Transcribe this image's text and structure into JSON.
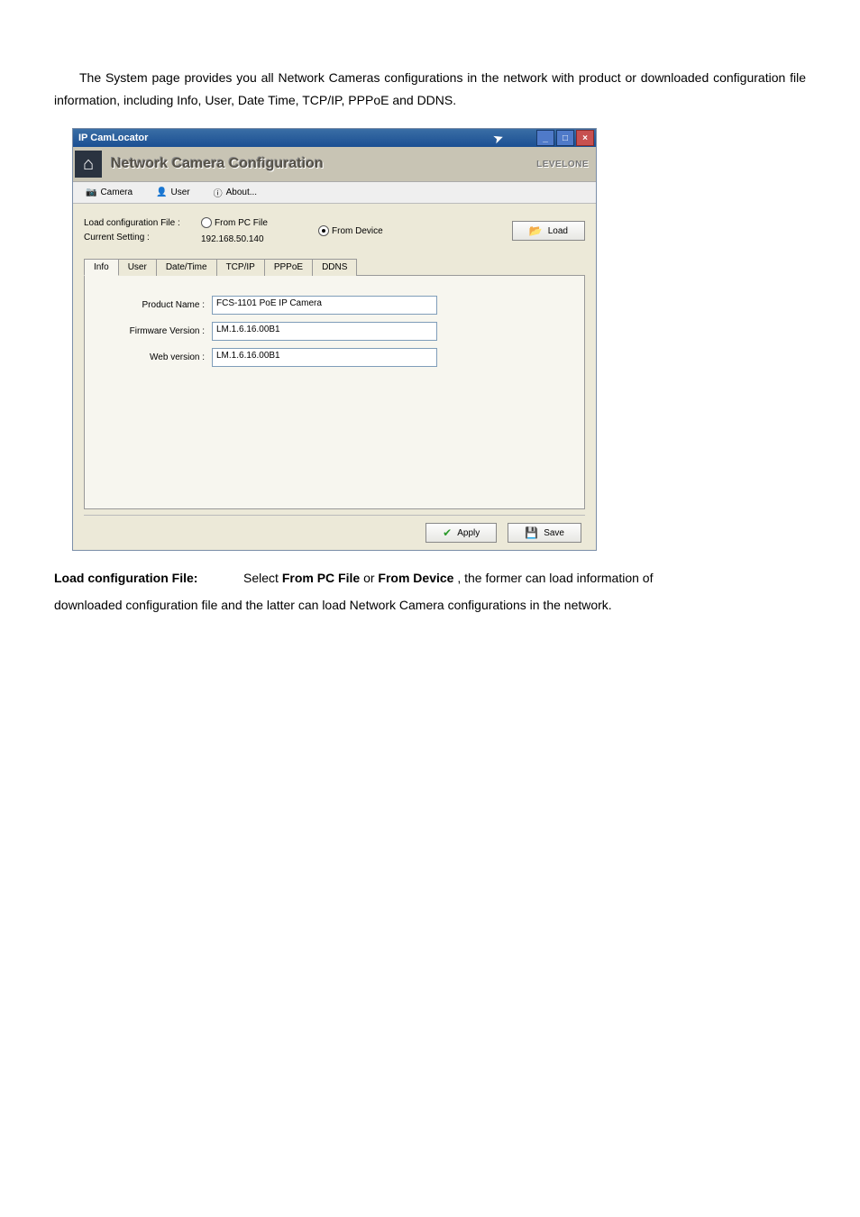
{
  "doc": {
    "para1": "The System page provides you all Network Cameras configurations in the network with product or downloaded configuration file information, including Info, User, Date Time, TCP/IP, PPPoE and DDNS.",
    "defn_term": "Load configuration File:",
    "defn_rest_1": "Select ",
    "defn_opt1": "From PC File",
    "defn_or": " or ",
    "defn_opt2": "From Device",
    "defn_rest_2": ", the former can load information of",
    "para2": "downloaded configuration file and the latter can load Network Camera configurations in the network."
  },
  "window": {
    "title": "IP CamLocator",
    "min": "_",
    "max": "□",
    "close": "×",
    "header_title": "Network Camera Configuration",
    "brand": "LEVELONE",
    "menu": {
      "camera": "Camera",
      "user": "User",
      "about": "About..."
    },
    "cfg": {
      "label_load": "Load configuration File :",
      "label_current": "Current Setting :",
      "current_value": "192.168.50.140",
      "radio_pc": "From PC File",
      "radio_dev": "From Device",
      "btn_load": "Load"
    },
    "tabs": {
      "info": "Info",
      "user": "User",
      "datetime": "Date/Time",
      "tcpip": "TCP/IP",
      "pppoe": "PPPoE",
      "ddns": "DDNS"
    },
    "fields": {
      "product_label": "Product Name :",
      "product_value": "FCS-1101 PoE IP Camera",
      "firmware_label": "Firmware Version :",
      "firmware_value": "LM.1.6.16.00B1",
      "web_label": "Web version :",
      "web_value": "LM.1.6.16.00B1"
    },
    "buttons": {
      "apply": "Apply",
      "save": "Save"
    }
  }
}
